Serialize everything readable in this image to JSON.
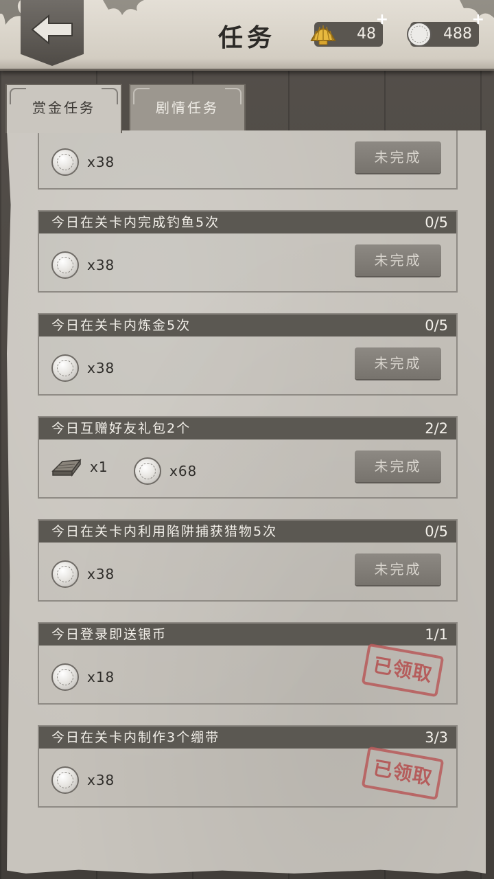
{
  "header": {
    "title": "任务",
    "currencies": [
      {
        "icon": "shell-icon",
        "amount": "48"
      },
      {
        "icon": "silver-coin-icon",
        "amount": "488"
      }
    ],
    "plus_label": "+"
  },
  "tabs": [
    {
      "label": "赏金任务",
      "active": true
    },
    {
      "label": "剧情任务",
      "active": false
    }
  ],
  "tasks": [
    {
      "name": "",
      "progress": "",
      "rewards": [
        {
          "icon": "silver-coin-icon",
          "amount": "x38"
        }
      ],
      "status": "未完成",
      "claimed": false
    },
    {
      "name": "今日在关卡内完成钓鱼5次",
      "progress": "0/5",
      "rewards": [
        {
          "icon": "silver-coin-icon",
          "amount": "x38"
        }
      ],
      "status": "未完成",
      "claimed": false
    },
    {
      "name": "今日在关卡内炼金5次",
      "progress": "0/5",
      "rewards": [
        {
          "icon": "silver-coin-icon",
          "amount": "x38"
        }
      ],
      "status": "未完成",
      "claimed": false
    },
    {
      "name": "今日互赠好友礼包2个",
      "progress": "2/2",
      "rewards": [
        {
          "icon": "wood-plank-icon",
          "amount": "x1"
        },
        {
          "icon": "silver-coin-icon",
          "amount": "x68"
        }
      ],
      "status": "未完成",
      "claimed": false
    },
    {
      "name": "今日在关卡内利用陷阱捕获猎物5次",
      "progress": "0/5",
      "rewards": [
        {
          "icon": "silver-coin-icon",
          "amount": "x38"
        }
      ],
      "status": "未完成",
      "claimed": false
    },
    {
      "name": "今日登录即送银币",
      "progress": "1/1",
      "rewards": [
        {
          "icon": "silver-coin-icon",
          "amount": "x18"
        }
      ],
      "status": "已领取",
      "claimed": true
    },
    {
      "name": "今日在关卡内制作3个绷带",
      "progress": "3/3",
      "rewards": [
        {
          "icon": "silver-coin-icon",
          "amount": "x38"
        }
      ],
      "status": "已领取",
      "claimed": true
    }
  ],
  "colors": {
    "header_bar": "#5b5852",
    "paper": "#c8c4bd",
    "stamp": "#b44e4e",
    "button": "#8d8983"
  }
}
